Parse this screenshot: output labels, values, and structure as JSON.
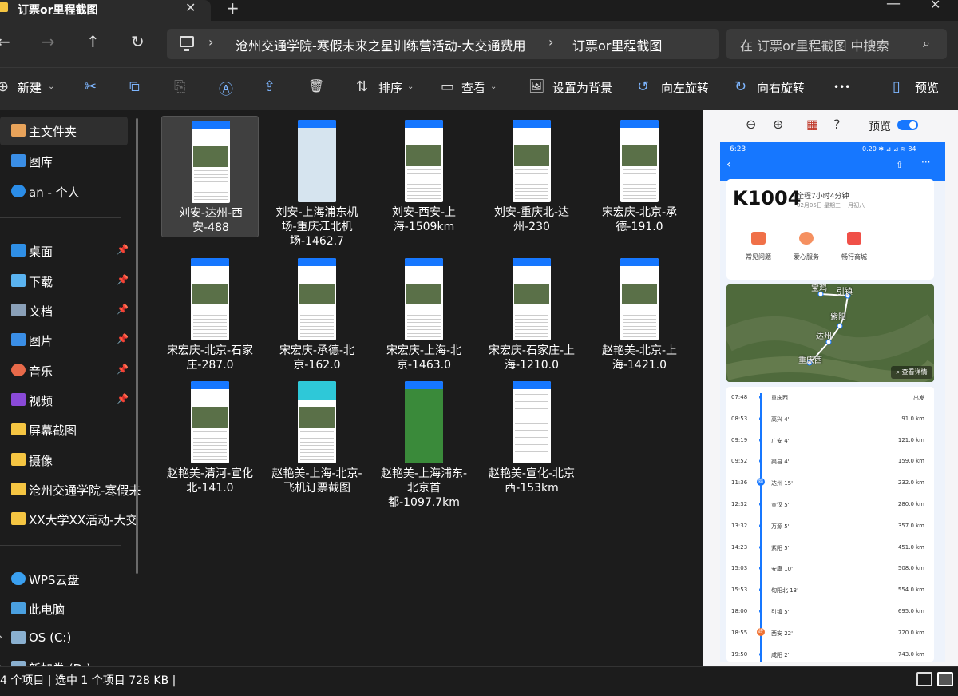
{
  "window": {
    "tab_title": "订票or里程截图",
    "close_symbol": "✕",
    "newtab_symbol": "+",
    "minimize_symbol": "—",
    "winclose_symbol": "✕"
  },
  "nav": {
    "back": "←",
    "forward": "→",
    "up": "↑",
    "refresh": "↻",
    "breadcrumbs": [
      "沧州交通学院-寒假未来之星训练营活动-大交通费用",
      "订票or里程截图"
    ],
    "search_placeholder": "在 订票or里程截图 中搜索",
    "search_icon": "⌕"
  },
  "toolbar": {
    "new_label": "新建",
    "sort_label": "排序",
    "view_label": "查看",
    "set_bg_label": "设置为背景",
    "rotate_left_label": "向左旋转",
    "rotate_right_label": "向右旋转",
    "more_label": "•••",
    "preview_label": "预览",
    "icons": {
      "new": "⊕",
      "cut": "✂",
      "copy": "⧉",
      "paste": "⎘",
      "rename": "Ⓐ",
      "share": "⇪",
      "delete": "🗑",
      "sort": "⇅",
      "view": "▭",
      "set_bg": "🖼",
      "rotate_left": "↺",
      "rotate_right": "↻",
      "preview": "▯"
    }
  },
  "sidebar": {
    "items": [
      {
        "label": "主文件夹",
        "icon": "home-icon",
        "color": "#e8a35a"
      },
      {
        "label": "图库",
        "icon": "gallery-icon",
        "color": "#3a8ee6"
      },
      {
        "label": "an - 个人",
        "icon": "cloud-icon",
        "color": "#2b8de8"
      },
      {
        "label": "桌面",
        "icon": "desktop-icon",
        "color": "#2f8fe6"
      },
      {
        "label": "下载",
        "icon": "download-icon",
        "color": "#5ab3f0"
      },
      {
        "label": "文档",
        "icon": "document-icon",
        "color": "#8aa0b8"
      },
      {
        "label": "图片",
        "icon": "pictures-icon",
        "color": "#3a8ee6"
      },
      {
        "label": "音乐",
        "icon": "music-icon",
        "color": "#e86a4a"
      },
      {
        "label": "视频",
        "icon": "video-icon",
        "color": "#8a4ad8"
      },
      {
        "label": "屏幕截图",
        "icon": "folder-icon",
        "color": "#f5c542"
      },
      {
        "label": "摄像",
        "icon": "folder-icon",
        "color": "#f5c542"
      },
      {
        "label": "沧州交通学院-寒假未",
        "icon": "folder-icon",
        "color": "#f5c542"
      },
      {
        "label": "XX大学XX活动-大交",
        "icon": "folder-icon",
        "color": "#f5c542"
      },
      {
        "label": "WPS云盘",
        "icon": "wps-cloud-icon",
        "color": "#3aa0f0"
      },
      {
        "label": "此电脑",
        "icon": "pc-icon",
        "color": "#4aa0e0"
      },
      {
        "label": "OS (C:)",
        "icon": "drive-icon",
        "color": "#8ab0d0"
      },
      {
        "label": "新加卷 (D:)",
        "icon": "drive-icon",
        "color": "#8ab0d0"
      }
    ],
    "pin_symbol": "📌",
    "expand_symbol": "›"
  },
  "files": [
    {
      "name": "刘安-达州-西安-488",
      "style": "blue"
    },
    {
      "name": "刘安-上海浦东机场-重庆江北机场-1462.7",
      "style": "mapwhite"
    },
    {
      "name": "刘安-西安-上海-1509km",
      "style": "blue"
    },
    {
      "name": "刘安-重庆北-达州-230",
      "style": "blue"
    },
    {
      "name": "宋宏庆-北京-承德-191.0",
      "style": "blue"
    },
    {
      "name": "宋宏庆-北京-石家庄-287.0",
      "style": "blue"
    },
    {
      "name": "宋宏庆-承德-北京-162.0",
      "style": "blue"
    },
    {
      "name": "宋宏庆-上海-北京-1463.0",
      "style": "blue"
    },
    {
      "name": "宋宏庆-石家庄-上海-1210.0",
      "style": "blue"
    },
    {
      "name": "赵艳美-北京-上海-1421.0",
      "style": "blue"
    },
    {
      "name": "赵艳美-清河-宣化北-141.0",
      "style": "blue"
    },
    {
      "name": "赵艳美-上海-北京-飞机订票截图",
      "style": "teal"
    },
    {
      "name": "赵艳美-上海浦东-北京首都-1097.7km",
      "style": "green"
    },
    {
      "name": "赵艳美-宣化-北京西-153km",
      "style": "plain"
    }
  ],
  "preview": {
    "label": "预览",
    "tool_icons": [
      "⊖",
      "⊕",
      "▦",
      "?"
    ],
    "phone": {
      "time": "6:23",
      "status": "0.20 ✱ ⊿ ⊿ ≋ 84",
      "back": "‹",
      "share": "⇧",
      "more": "···",
      "train_no": "K1004",
      "duration": "全程7小时4分钟",
      "date": "02月05日 星期三 一月初八",
      "services": [
        "常见问题",
        "爱心服务",
        "畅行商城"
      ],
      "map_labels": [
        "宝鸡",
        "引镇",
        "紫阳",
        "达州",
        "重庆西"
      ],
      "map_detail": "⌕ 查看详情",
      "stops": [
        {
          "time": "07:48",
          "name": "重庆西",
          "km": "出发",
          "badge": ""
        },
        {
          "time": "08:53",
          "name": "高兴 4'",
          "km": "91.0 km",
          "badge": ""
        },
        {
          "time": "09:19",
          "name": "广安 4'",
          "km": "121.0 km",
          "badge": ""
        },
        {
          "time": "09:52",
          "name": "渠县 4'",
          "km": "159.0 km",
          "badge": ""
        },
        {
          "time": "11:36",
          "name": "达州 15'",
          "km": "232.0 km",
          "badge": "始"
        },
        {
          "time": "12:32",
          "name": "宣汉 5'",
          "km": "280.0 km",
          "badge": ""
        },
        {
          "time": "13:32",
          "name": "万源 5'",
          "km": "357.0 km",
          "badge": ""
        },
        {
          "time": "14:23",
          "name": "紫阳 5'",
          "km": "451.0 km",
          "badge": ""
        },
        {
          "time": "15:03",
          "name": "安康 10'",
          "km": "508.0 km",
          "badge": ""
        },
        {
          "time": "15:53",
          "name": "旬阳北 13'",
          "km": "554.0 km",
          "badge": ""
        },
        {
          "time": "18:00",
          "name": "引镇 5'",
          "km": "695.0 km",
          "badge": ""
        },
        {
          "time": "18:55",
          "name": "西安 22'",
          "km": "720.0 km",
          "badge": "终"
        },
        {
          "time": "19:50",
          "name": "咸阳 2'",
          "km": "743.0 km",
          "badge": ""
        }
      ]
    }
  },
  "status": {
    "text": "4 个项目  |  选中 1 个项目  728 KB  |"
  },
  "colors": {
    "accent": "#1677ff",
    "window_bg": "#1c1c1c",
    "bar_bg": "#2b2b2b"
  }
}
